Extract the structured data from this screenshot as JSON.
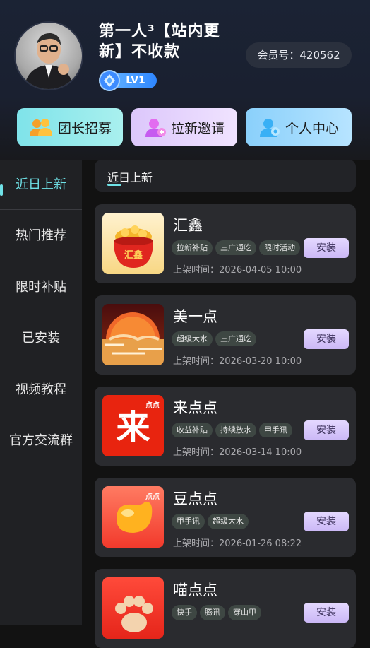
{
  "header": {
    "username": "第一人³【站内更新】不收款",
    "member_label": "会员号：420562",
    "level": "LV1"
  },
  "quick_actions": [
    {
      "label": "团长招募",
      "icon": "team-icon"
    },
    {
      "label": "拉新邀请",
      "icon": "invite-icon"
    },
    {
      "label": "个人中心",
      "icon": "profile-icon"
    }
  ],
  "sidebar": {
    "items": [
      {
        "label": "近日上新",
        "active": true
      },
      {
        "label": "热门推荐",
        "active": false
      },
      {
        "label": "限时补贴",
        "active": false
      },
      {
        "label": "已安装",
        "active": false
      },
      {
        "label": "视频教程",
        "active": false
      },
      {
        "label": "官方交流群",
        "active": false
      }
    ]
  },
  "section": {
    "title": "近日上新"
  },
  "apps": [
    {
      "name": "汇鑫",
      "tags": [
        "拉新补贴",
        "三广通吃",
        "限时活动"
      ],
      "time": "上架时间：2026-04-05 10:00",
      "install": "安装",
      "icon": "treasure-pot-icon"
    },
    {
      "name": "美一点",
      "tags": [
        "超级大水",
        "三广通吃"
      ],
      "time": "上架时间：2026-03-20 10:00",
      "install": "安装",
      "icon": "sunset-icon"
    },
    {
      "name": "来点点",
      "tags": [
        "收益补贴",
        "持续放水",
        "甲手讯"
      ],
      "time": "上架时间：2026-03-14 10:00",
      "install": "安装",
      "icon": "lai-char-icon",
      "icon_char": "来",
      "icon_badge": "点点"
    },
    {
      "name": "豆点点",
      "tags": [
        "甲手讯",
        "超级大水"
      ],
      "time": "上架时间：2026-01-26 08:22",
      "install": "安装",
      "icon": "bean-icon",
      "icon_badge": "点点"
    },
    {
      "name": "喵点点",
      "tags": [
        "快手",
        "腾讯",
        "穿山甲"
      ],
      "time": "",
      "install": "安装",
      "icon": "paw-icon"
    }
  ]
}
